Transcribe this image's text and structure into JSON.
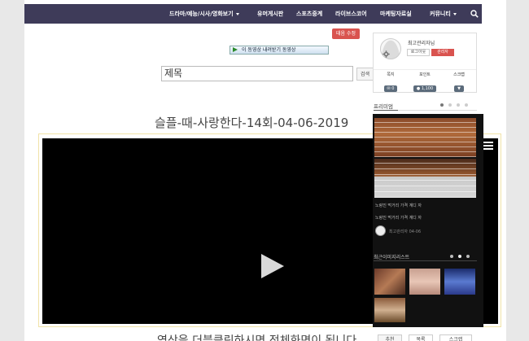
{
  "nav": {
    "items": [
      {
        "label": "드라마/예능/시사/영화보기",
        "dropdown": true
      },
      {
        "label": "유머게시판",
        "dropdown": false
      },
      {
        "label": "스포츠중계",
        "dropdown": false
      },
      {
        "label": "라이브스코어",
        "dropdown": false
      },
      {
        "label": "마케팅자료실",
        "dropdown": false
      },
      {
        "label": "커뮤니티",
        "dropdown": true
      }
    ],
    "search_icon": "search-icon"
  },
  "tag_button": "태음 수정",
  "download_banner": "이 동영상 내려받기 동영상",
  "search": {
    "value": "제목",
    "button_label": "검색"
  },
  "post": {
    "title": "슬플-때-사랑한다-14회-04-06-2019",
    "footer_text": "영상을 더블클릭하시면 전체화면이 됩니다",
    "buttons": [
      "추천",
      "목록",
      "스크랩"
    ]
  },
  "profile": {
    "username": "최고관리자님",
    "logout_label": "로그아웃",
    "admin_label": "관리자",
    "stats": [
      {
        "label": "쪽지",
        "value": "0"
      },
      {
        "label": "포인트",
        "value": "1,100"
      },
      {
        "label": "스크랩",
        "value": ""
      }
    ]
  },
  "sidebar": {
    "premium_title": "프리미엄",
    "caption_1": "노량진 먹거리 가격 계디 자",
    "caption_2": "노량진 먹거리 가격 계디 자",
    "author": "최고관리자 04-06",
    "recent_title": "최근이미지리스트"
  },
  "colors": {
    "nav_bg": "#3e3b59",
    "accent_red": "#d9534f"
  }
}
